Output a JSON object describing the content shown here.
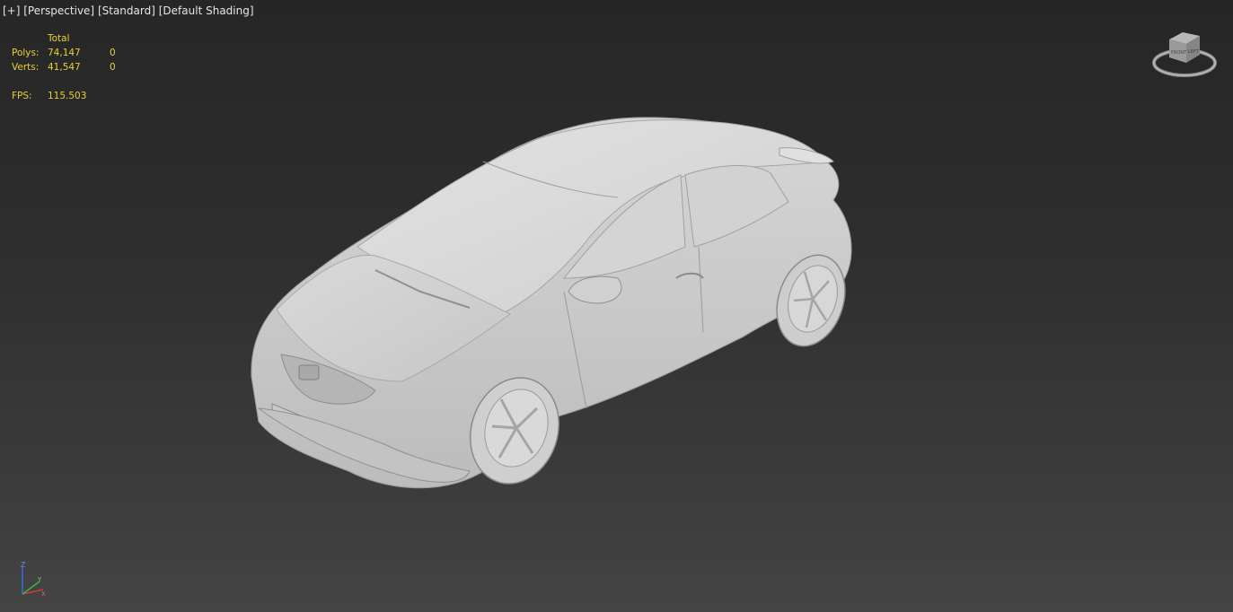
{
  "viewport": {
    "menu_plus": "[+]",
    "view": "[Perspective]",
    "style": "[Standard]",
    "shading": "[Default Shading]"
  },
  "stats": {
    "header_total": "Total",
    "polys_label": "Polys:",
    "polys_total": "74,147",
    "polys_selected": "0",
    "verts_label": "Verts:",
    "verts_total": "41,547",
    "verts_selected": "0",
    "fps_label": "FPS:",
    "fps_value": "115.503"
  },
  "viewcube": {
    "face_front": "FRONT",
    "face_left": "LEFT",
    "icon": "viewcube-icon"
  },
  "axis": {
    "z_label": "Z",
    "x_label": "X",
    "y_label": "Y"
  },
  "colors": {
    "text_label": "#e6e6e6",
    "stats_yellow": "#e8d038",
    "model_gray": "#d8d8d8",
    "bg_top": "#262626",
    "bg_bottom": "#444444"
  }
}
